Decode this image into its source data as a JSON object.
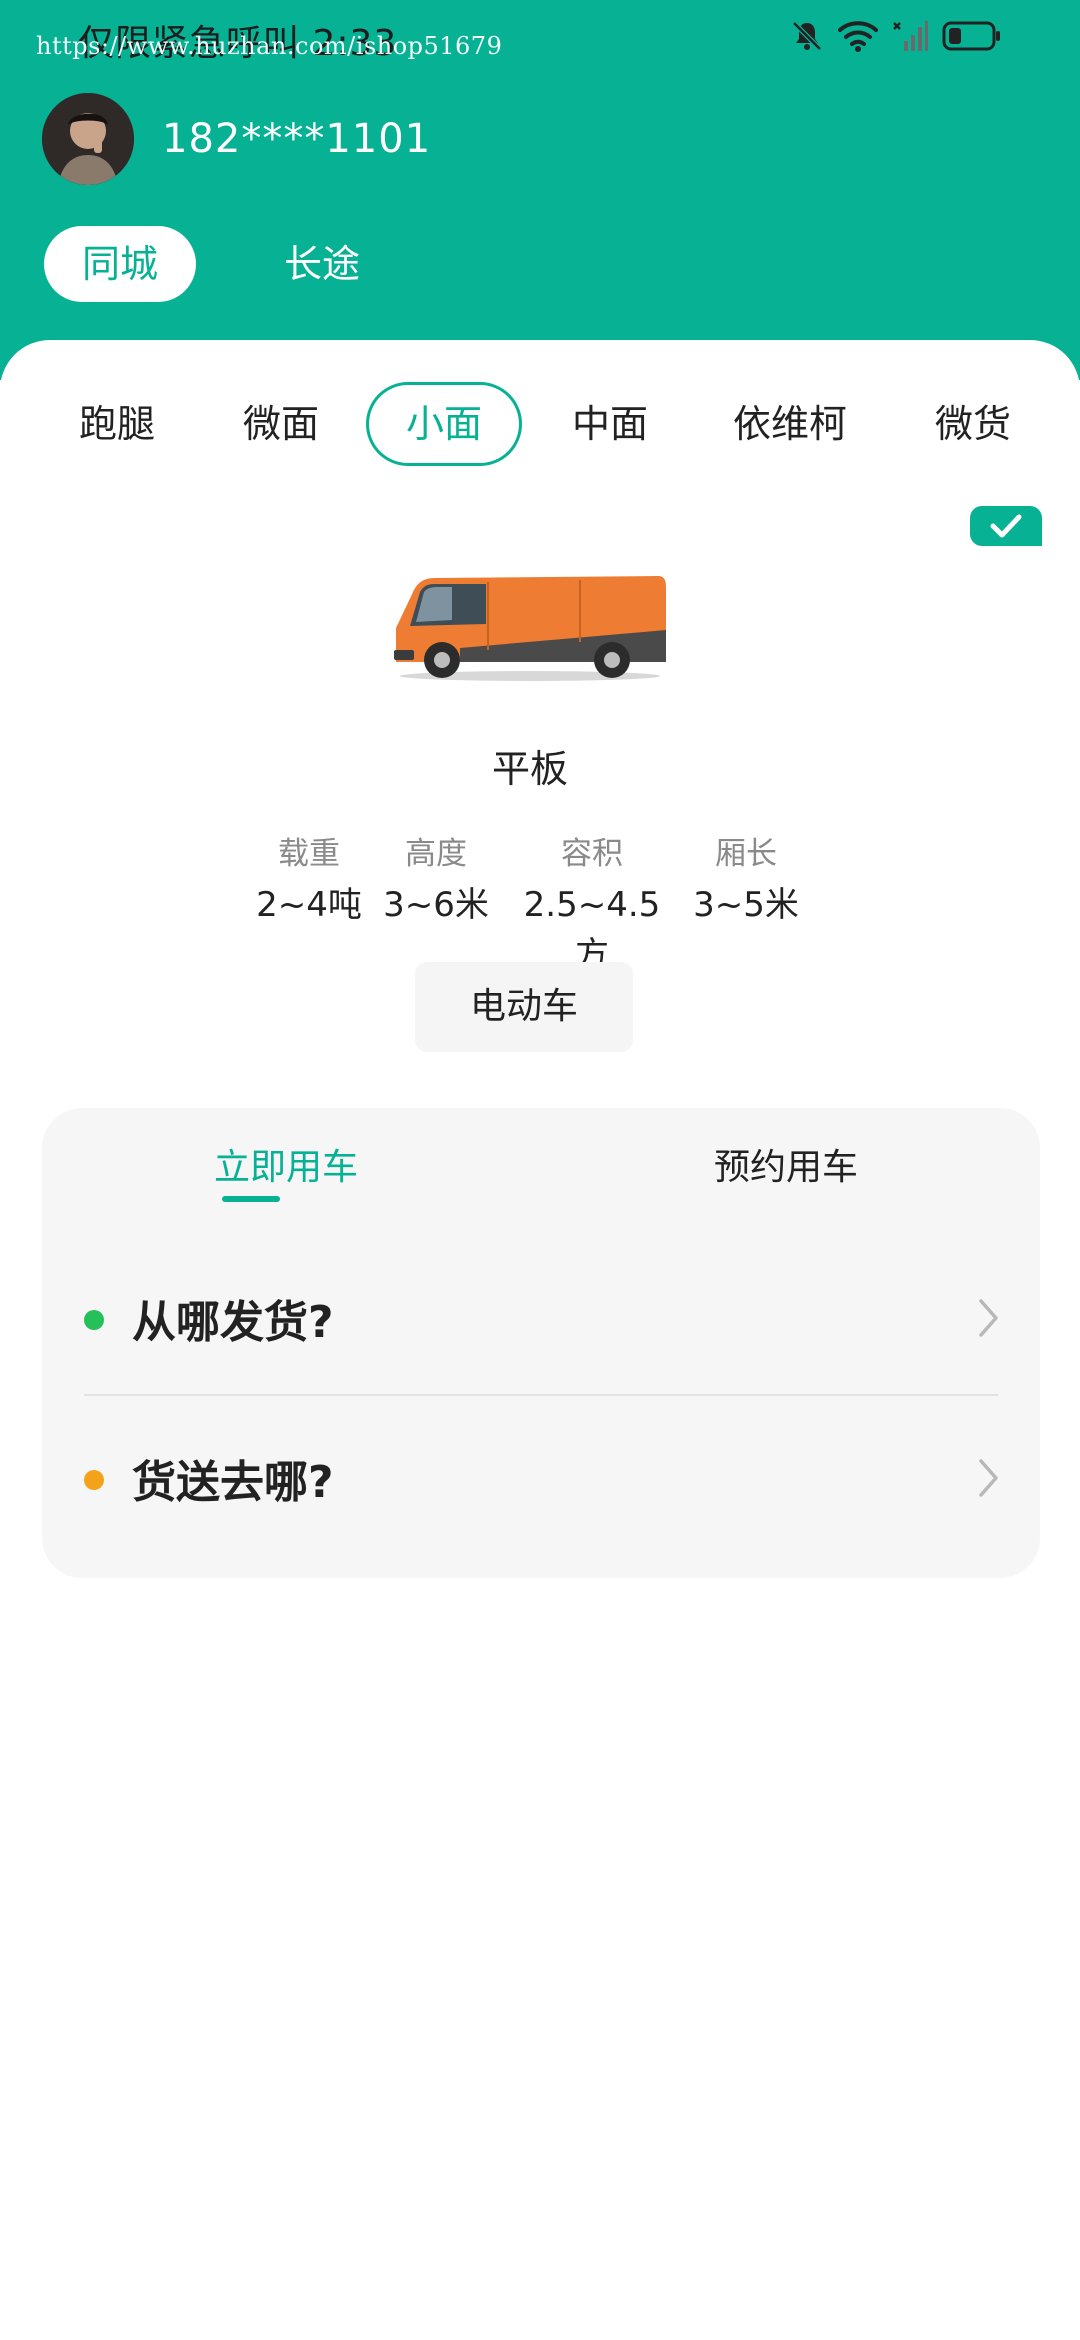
{
  "status_bar": {
    "text": "仅限紧急呼叫 2:33",
    "watermark": "https://www.huzhan.com/ishop51679",
    "icons": [
      "bell-off-icon",
      "wifi-icon",
      "signal-icon",
      "battery-icon"
    ]
  },
  "user": {
    "phone": "182****1101",
    "avatar": "avatar-photo"
  },
  "scope_tabs": [
    {
      "label": "同城",
      "active": true
    },
    {
      "label": "长途",
      "active": false
    }
  ],
  "vehicle_types": [
    {
      "label": "跑腿"
    },
    {
      "label": "微面"
    },
    {
      "label": "小面",
      "active": true
    },
    {
      "label": "中面"
    },
    {
      "label": "依维柯"
    },
    {
      "label": "微货"
    }
  ],
  "vehicle": {
    "name": "平板",
    "selected": true,
    "specs": [
      {
        "label": "载重",
        "value": "2~4吨"
      },
      {
        "label": "高度",
        "value": "3~6米"
      },
      {
        "label": "容积",
        "value": "2.5~4.5方"
      },
      {
        "label": "厢长",
        "value": "3~5米"
      }
    ],
    "energy_option": "电动车"
  },
  "order": {
    "tabs": [
      {
        "label": "立即用车",
        "active": true
      },
      {
        "label": "预约用车",
        "active": false
      }
    ],
    "pickup_placeholder": "从哪发货?",
    "dropoff_placeholder": "货送去哪?"
  },
  "colors": {
    "brand": "#06b194",
    "pickup_dot": "#25c05a",
    "dropoff_dot": "#f4a21a",
    "card_bg": "#f6f6f6"
  }
}
